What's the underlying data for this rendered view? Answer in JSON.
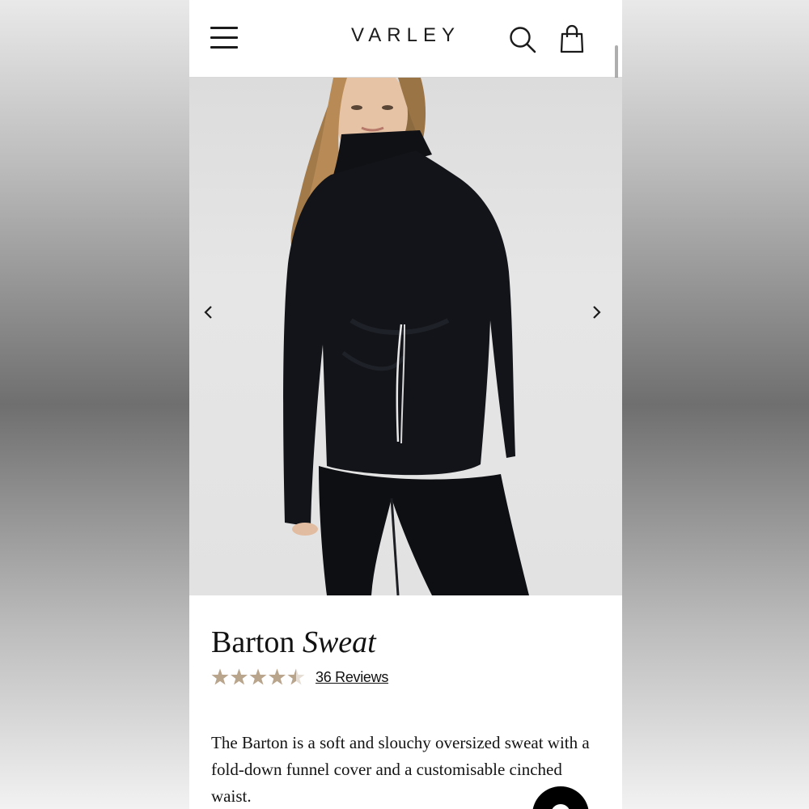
{
  "header": {
    "brand": "VARLEY",
    "menu_icon": "hamburger-menu-icon",
    "search_icon": "search-icon",
    "bag_icon": "shopping-bag-icon"
  },
  "gallery": {
    "image_alt": "Model wearing black Barton Sweat with white drawstring",
    "prev_icon": "chevron-left-icon",
    "next_icon": "chevron-right-icon"
  },
  "product": {
    "title_plain": "Barton",
    "title_italic": "Sweat",
    "rating": 4.5,
    "rating_max": 5,
    "reviews_label": "36 Reviews",
    "description": "The Barton is a soft and slouchy oversized sweat with a fold-down funnel cover and a customisable cinched waist."
  },
  "colors": {
    "star": "#b9a48c",
    "text": "#111111",
    "header_border": "#d9d9d9"
  },
  "chat": {
    "icon": "chat-bubble-icon"
  }
}
